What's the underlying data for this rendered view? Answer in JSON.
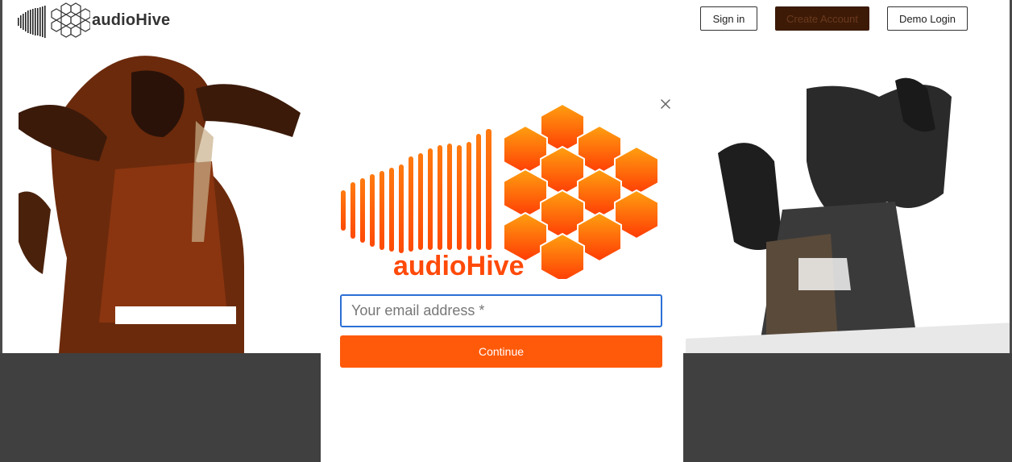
{
  "nav": {
    "brand": "audioHive",
    "sign_in_label": "Sign in",
    "create_account_label": "Create Account",
    "demo_login_label": "Demo Login"
  },
  "modal": {
    "brand": "audioHive",
    "email_placeholder": "Your email address *",
    "email_value": "",
    "continue_label": "Continue",
    "close_icon": "close-icon"
  },
  "colors": {
    "accent": "#ff5a0a",
    "input_focus": "#2b6fd6",
    "create_account_bg": "#3d1a06",
    "background_band": "#404040"
  }
}
